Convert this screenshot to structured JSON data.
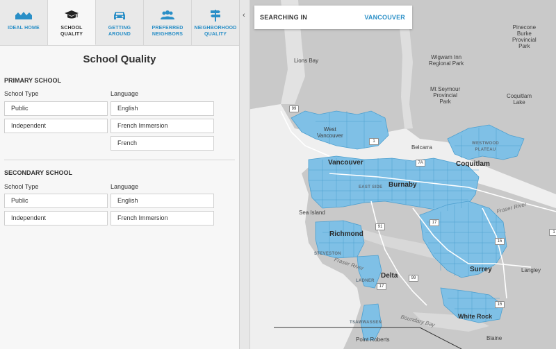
{
  "tabs": [
    {
      "label": "IDEAL HOME",
      "icon": "houses-icon",
      "active": false
    },
    {
      "label": "SCHOOL\nQUALITY",
      "icon": "graduation-cap-icon",
      "active": true
    },
    {
      "label": "GETTING\nAROUND",
      "icon": "car-icon",
      "active": false
    },
    {
      "label": "PREFERRED\nNEIGHBORS",
      "icon": "people-icon",
      "active": false
    },
    {
      "label": "NEIGHBORHOOD\nQUALITY",
      "icon": "signpost-icon",
      "active": false
    }
  ],
  "panel": {
    "title": "School Quality",
    "primary": {
      "heading": "PRIMARY SCHOOL",
      "type_label": "School Type",
      "language_label": "Language",
      "types": [
        "Public",
        "Independent"
      ],
      "languages": [
        "English",
        "French Immersion",
        "French"
      ]
    },
    "secondary": {
      "heading": "SECONDARY SCHOOL",
      "type_label": "School Type",
      "language_label": "Language",
      "types": [
        "Public",
        "Independent"
      ],
      "languages": [
        "English",
        "French Immersion"
      ]
    }
  },
  "map": {
    "search_label": "SEARCHING IN",
    "search_value": "VANCOUVER",
    "collapse_icon": "chevron-left-icon",
    "labels": {
      "lions_bay": "Lions Bay",
      "wigwam": "Wigwam Inn\nRegional Park",
      "pinecone": "Pinecone\nBurke\nProvincial\nPark",
      "mt_seymour": "Mt Seymour\nProvincial\nPark",
      "coquitlam_lake": "Coquitlam\nLake",
      "west_vancouver": "West\nVancouver",
      "belcarra": "Belcarra",
      "westwood": "WESTWOOD\nPLATEAU",
      "vancouver": "Vancouver",
      "coquitlam": "Coquitlam",
      "east_side": "EAST SIDE",
      "burnaby": "Burnaby",
      "fraser_river_e": "Fraser River",
      "sea_island": "Sea Island",
      "richmond": "Richmond",
      "steveston": "STEVESTON",
      "fraser_river_w": "Fraser River",
      "delta": "Delta",
      "ladner": "LADNER",
      "surrey": "Surrey",
      "langley": "Langley",
      "boundary_bay": "Boundary Bay",
      "white_rock": "White Rock",
      "tsawwassen": "TSAWWASSEN",
      "point_roberts": "Point Roberts",
      "blaine": "Blaine"
    },
    "highways": [
      "99",
      "1",
      "7A",
      "91",
      "17",
      "99",
      "17",
      "15",
      "15",
      "1"
    ],
    "colors": {
      "region_fill": "#7fc0e6",
      "region_stroke": "#4c9fcf",
      "land": "#c9c9c9",
      "water": "#efefef"
    }
  }
}
